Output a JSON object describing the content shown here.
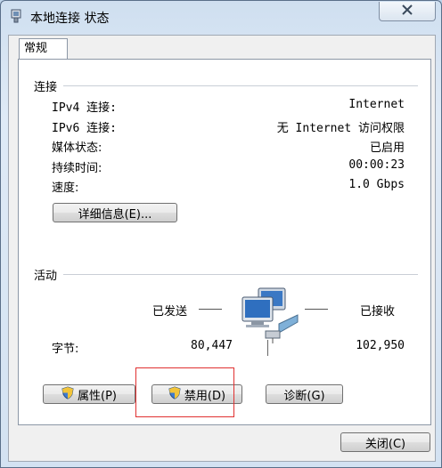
{
  "window": {
    "title": "本地连接 状态"
  },
  "tabs": [
    {
      "label": "常规"
    }
  ],
  "connection": {
    "group_label": "连接",
    "rows": [
      {
        "label": "IPv4 连接:",
        "value": "Internet"
      },
      {
        "label": "IPv6 连接:",
        "value": "无 Internet 访问权限"
      },
      {
        "label": "媒体状态:",
        "value": "已启用"
      },
      {
        "label": "持续时间:",
        "value": "00:00:23"
      },
      {
        "label": "速度:",
        "value": "1.0 Gbps"
      }
    ],
    "details_button": "详细信息(E)..."
  },
  "activity": {
    "group_label": "活动",
    "sent_label": "已发送",
    "received_label": "已接收",
    "bytes_label": "字节:",
    "sent_bytes": "80,447",
    "received_bytes": "102,950"
  },
  "buttons": {
    "properties": "属性(P)",
    "disable": "禁用(D)",
    "diagnose": "诊断(G)",
    "close": "关闭(C)"
  },
  "icons": {
    "title": "network-adapter-icon",
    "window_close": "close-icon",
    "activity": "network-computers-icon",
    "shield": "uac-shield-icon"
  },
  "colors": {
    "highlight_box": "#e03030",
    "title_bg": "#cfdff0"
  }
}
